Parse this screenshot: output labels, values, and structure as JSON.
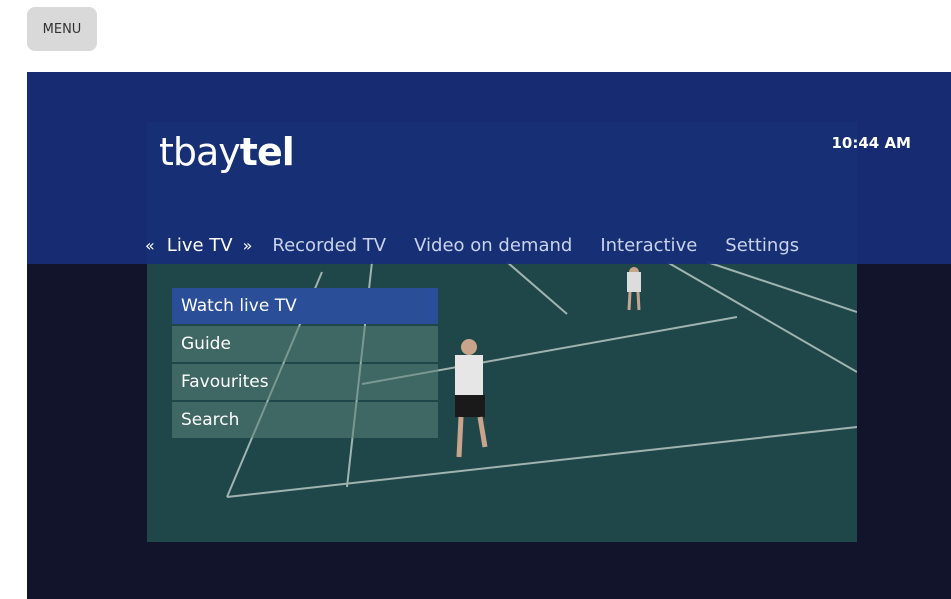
{
  "menu_button": {
    "label": "MENU"
  },
  "header": {
    "logo": {
      "light": "tbay",
      "bold": "tel"
    },
    "time": "10:44 AM"
  },
  "nav": {
    "prev_icon": "«",
    "next_icon": "»",
    "active": "Live TV",
    "items": [
      "Recorded TV",
      "Video on demand",
      "Interactive",
      "Settings"
    ]
  },
  "submenu": {
    "items": [
      "Watch live TV",
      "Guide",
      "Favourites",
      "Search"
    ],
    "selected_index": 0
  },
  "colors": {
    "header_bar": "#172e78",
    "selected_item": "#2b4e98",
    "background": "#11142a"
  }
}
